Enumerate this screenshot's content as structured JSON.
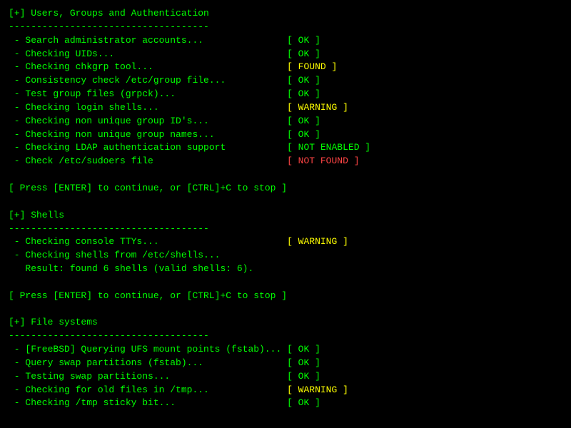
{
  "sections": [
    {
      "id": "users-groups",
      "header": "[+] Users, Groups and Authentication",
      "divider": "------------------------------------",
      "items": [
        {
          "label": " - Search administrator accounts...",
          "status": "[ OK ]",
          "status_class": "status-ok"
        },
        {
          "label": " - Checking UIDs...",
          "status": "[ OK ]",
          "status_class": "status-ok"
        },
        {
          "label": " - Checking chkgrp tool...",
          "status": "[ FOUND ]",
          "status_class": "status-found"
        },
        {
          "label": " - Consistency check /etc/group file...",
          "status": "[ OK ]",
          "status_class": "status-ok"
        },
        {
          "label": " - Test group files (grpck)...",
          "status": "[ OK ]",
          "status_class": "status-ok"
        },
        {
          "label": " - Checking login shells...",
          "status": "[ WARNING ]",
          "status_class": "status-warning"
        },
        {
          "label": " - Checking non unique group ID's...",
          "status": "[ OK ]",
          "status_class": "status-ok"
        },
        {
          "label": " - Checking non unique group names...",
          "status": "[ OK ]",
          "status_class": "status-ok"
        },
        {
          "label": " - Checking LDAP authentication support",
          "status": "[ NOT ENABLED ]",
          "status_class": "status-not-enabled"
        },
        {
          "label": " - Check /etc/sudoers file",
          "status": "[ NOT FOUND ]",
          "status_class": "status-not-found"
        }
      ],
      "prompt": "[ Press [ENTER] to continue, or [CTRL]+C to stop ]"
    },
    {
      "id": "shells",
      "header": "[+] Shells",
      "divider": "------------------------------------",
      "items": [
        {
          "label": " - Checking console TTYs...",
          "status": "[ WARNING ]",
          "status_class": "status-warning"
        },
        {
          "label": " - Checking shells from /etc/shells...",
          "status": "",
          "status_class": ""
        },
        {
          "label": "   Result: found 6 shells (valid shells: 6).",
          "status": "",
          "status_class": ""
        }
      ],
      "prompt": "[ Press [ENTER] to continue, or [CTRL]+C to stop ]"
    },
    {
      "id": "filesystems",
      "header": "[+] File systems",
      "divider": "------------------------------------",
      "items": [
        {
          "label": " - [FreeBSD] Querying UFS mount points (fstab)...",
          "status": "[ OK ]",
          "status_class": "status-ok"
        },
        {
          "label": " - Query swap partitions (fstab)...",
          "status": "[ OK ]",
          "status_class": "status-ok"
        },
        {
          "label": " - Testing swap partitions...",
          "status": "[ OK ]",
          "status_class": "status-ok"
        },
        {
          "label": " - Checking for old files in /tmp...",
          "status": "[ WARNING ]",
          "status_class": "status-warning"
        },
        {
          "label": " - Checking /tmp sticky bit...",
          "status": "[ OK ]",
          "status_class": "status-ok"
        }
      ],
      "prompt": ""
    }
  ]
}
